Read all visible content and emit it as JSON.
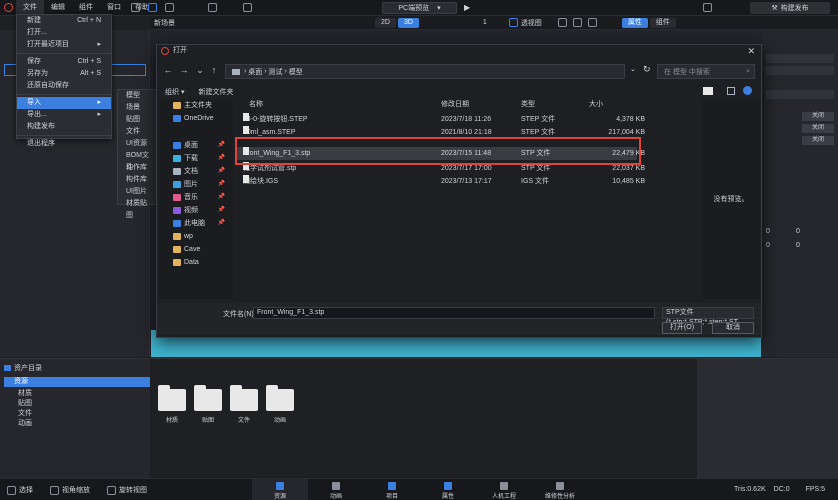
{
  "menubar": {
    "items": [
      "文件",
      "编辑",
      "组件",
      "窗口",
      "帮助"
    ]
  },
  "platform_button": "PC端预览",
  "publish_button": "构建发布",
  "scene_title": "新场景",
  "view_modes": [
    "2D",
    "3D"
  ],
  "top_controls": {
    "count": "1",
    "display": "透视图"
  },
  "right_tabs": [
    "属性",
    "组件"
  ],
  "file_menu": {
    "items": [
      {
        "label": "新建",
        "shortcut": "Ctrl + N"
      },
      {
        "label": "打开...",
        "shortcut": ""
      },
      {
        "label": "打开最近项目",
        "shortcut": "▸"
      },
      {
        "label": "保存",
        "shortcut": "Ctrl + S"
      },
      {
        "label": "另存为",
        "shortcut": "Alt + S"
      },
      {
        "label": "还原自动保存",
        "shortcut": ""
      },
      {
        "label": "导入",
        "shortcut": "▸"
      },
      {
        "label": "导出...",
        "shortcut": "▸"
      },
      {
        "label": "构建发布",
        "shortcut": ""
      },
      {
        "label": "退出程序",
        "shortcut": ""
      }
    ]
  },
  "import_submenu": [
    "模型",
    "场景",
    "贴图",
    "文件",
    "UI资源",
    "BOM文件",
    "动作库",
    "构件库",
    "UI图片",
    "材质贴图"
  ],
  "dialog": {
    "title": "打开",
    "address": [
      "桌面",
      "测试",
      "模型"
    ],
    "search_placeholder": "在 模型 中搜索",
    "organize": "组织 ▾",
    "new_folder": "新建文件夹",
    "sidebar": [
      {
        "label": "主文件夹",
        "color": "#e2b35a"
      },
      {
        "label": "OneDrive",
        "color": "#3b7fe0"
      },
      {
        "label": "桌面",
        "color": "#3b7fe0"
      },
      {
        "label": "下载",
        "color": "#3bb0e0"
      },
      {
        "label": "文档",
        "color": "#aab2c0"
      },
      {
        "label": "图片",
        "color": "#3b9fe0"
      },
      {
        "label": "音乐",
        "color": "#e05a8a"
      },
      {
        "label": "视频",
        "color": "#8a5ae0"
      },
      {
        "label": "此电脑",
        "color": "#3b7fe0"
      },
      {
        "label": "wp",
        "color": "#e2b35a"
      },
      {
        "label": "Cave",
        "color": "#e2b35a"
      },
      {
        "label": "Data",
        "color": "#e2b35a"
      }
    ],
    "columns": [
      "名称",
      "修改日期",
      "类型",
      "大小"
    ],
    "files": [
      {
        "name": "34-0-旋转按钮.STEP",
        "date": "2023/7/18 11:26",
        "type": "STEP 文件",
        "size": "4,378 KB"
      },
      {
        "name": "30ml_asm.STEP",
        "date": "2021/8/10 21:18",
        "type": "STEP 文件",
        "size": "217,004 KB"
      },
      {
        "name": "Front_Wing_F1_3.stp",
        "date": "2023/7/15 11:48",
        "type": "STP 文件",
        "size": "22,479 KB"
      },
      {
        "name": "化学试剂试管.stp",
        "date": "2023/7/17 17:00",
        "type": "STP 文件",
        "size": "22,037 KB"
      },
      {
        "name": "测绘块.IGS",
        "date": "2023/7/13 17:17",
        "type": "IGS 文件",
        "size": "10,485 KB"
      }
    ],
    "selected_index": 2,
    "preview_text": "没有预览。",
    "filename_label": "文件名(N):",
    "filename_value": "Front_Wing_F1_3.stp",
    "filetype_value": "STP文件(*.stp;*.STP;*.step;*.ST",
    "open_button": "打开(O)",
    "cancel_button": "取消"
  },
  "right_panel": {
    "off_labels": [
      "关闭",
      "关闭",
      "关闭"
    ],
    "numbers": [
      "0",
      "0",
      "0",
      "0"
    ]
  },
  "asset_panel": {
    "title": "资产目录",
    "root": "资源",
    "tree": [
      "材质",
      "贴图",
      "文件",
      "动画"
    ],
    "folders": [
      "材质",
      "贴图",
      "文件",
      "动画"
    ]
  },
  "bottom_left": [
    "选择",
    "视角缩放",
    "旋转视图"
  ],
  "bottom_tabs": [
    "资源",
    "动画",
    "项目",
    "属性",
    "人机工程",
    "维修性分析"
  ],
  "status": {
    "tris": "Tris:0.62K",
    "dc": "DC:0",
    "fps": "FPS:5"
  },
  "colors": {
    "accent": "#3b7fe0",
    "highlight_box": "#e0433a",
    "viewport": "#3fb4cf"
  }
}
